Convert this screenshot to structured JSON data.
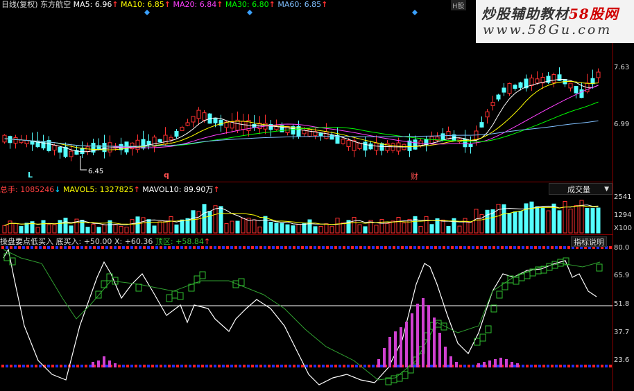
{
  "header": {
    "period": "日线(复权)",
    "stock_name": "东方航空",
    "ma5_label": "MA5:",
    "ma5_value": "6.96",
    "ma10_label": "MA10:",
    "ma10_value": "6.85",
    "ma20_label": "MA20:",
    "ma20_value": "6.84",
    "ma30_label": "MA30:",
    "ma30_value": "6.80",
    "ma60_label": "MA60:",
    "ma60_value": "6.85",
    "h_label": "H股"
  },
  "watermark": {
    "title_black": "炒股辅助教材",
    "title_red": "58股网",
    "url": "www.58Gu.com"
  },
  "price_axis": {
    "tick1": "7.63",
    "tick2": "6.99"
  },
  "price_markers": {
    "low_label": "6.45",
    "mark_l": "L",
    "mark_q": "q",
    "mark_cai": "财"
  },
  "volume_header": {
    "total_label": "总手:",
    "total_value": "1085246",
    "mavol5_label": "MAVOL5:",
    "mavol5_value": "1327825",
    "mavol10_label": "MAVOL10:",
    "mavol10_value": "89.90万"
  },
  "volume_selector": {
    "value": "成交量"
  },
  "volume_axis": {
    "tick1": "2541",
    "tick2": "1294",
    "unit": "X100"
  },
  "indicator_header": {
    "name": "操盘要点低买入",
    "bottom_buy_label": "底买入:",
    "bottom_buy_value": "+50.00",
    "x_label": "X:",
    "x_value": "+60.36",
    "top_label": "顶区:",
    "top_value": "+58.84"
  },
  "indicator_help": "指标说明",
  "indicator_axis": {
    "t1": "80.0",
    "t2": "65.9",
    "t3": "51.8",
    "t4": "37.7",
    "t5": "23.6"
  },
  "colors": {
    "up": "#ff3030",
    "down": "#54ffff",
    "ma5": "#ffffff",
    "ma10": "#ffff00",
    "ma20": "#ff40ff",
    "ma30": "#00ff00",
    "ma60": "#80c0ff"
  }
}
